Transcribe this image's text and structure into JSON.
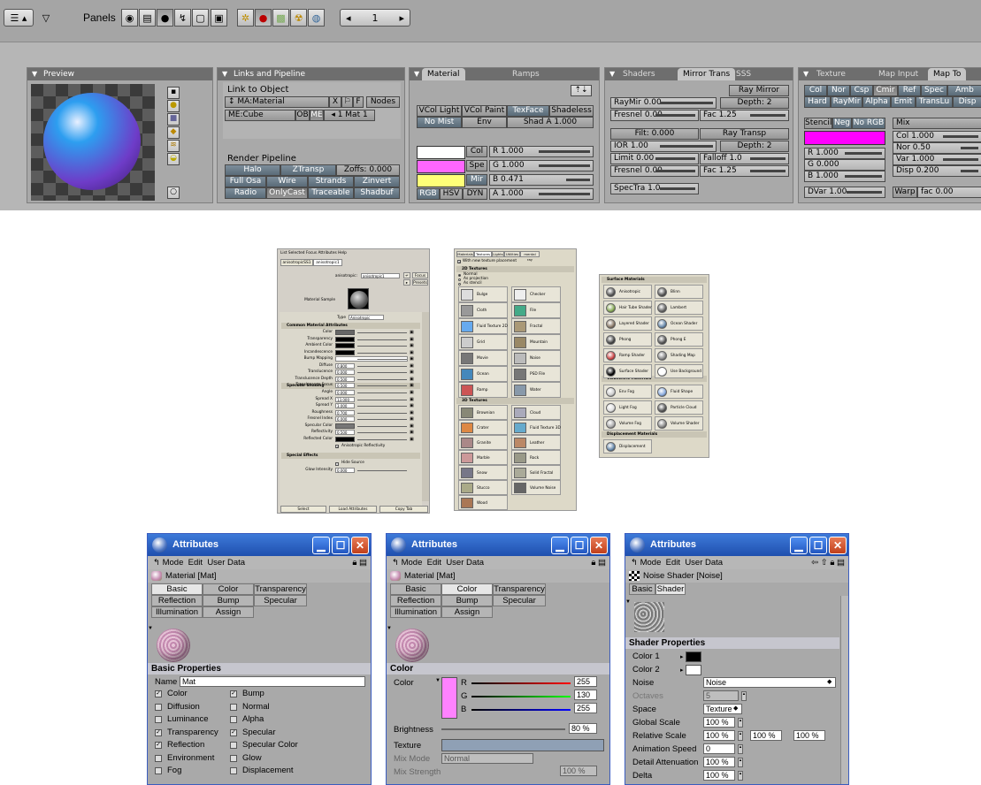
{
  "blender": {
    "header": {
      "panels_label": "Panels",
      "frame": "1"
    },
    "preview": {
      "title": "Preview"
    },
    "links": {
      "title": "Links and Pipeline",
      "link_to_object": "Link to Object",
      "ma_field": "MA:Material",
      "btn_x": "X",
      "btn_f": "F",
      "btn_nodes": "Nodes",
      "me_field": "ME:Cube",
      "ob": "OB",
      "me": "ME",
      "mat_index": "1 Mat 1",
      "render_pipeline": "Render Pipeline",
      "pipeline_rows": [
        [
          "Halo",
          "ZTransp",
          "Zoffs: 0.000"
        ],
        [
          "Full Osa",
          "Wire",
          "Strands",
          "Zinvert"
        ],
        [
          "Radio",
          "OnlyCast",
          "Traceable",
          "Shadbuf"
        ]
      ]
    },
    "material": {
      "title": "Material",
      "tab_ramps": "Ramps",
      "row1": [
        "VCol Light",
        "VCol Paint",
        "TexFace",
        "Shadeless"
      ],
      "row2": [
        "No Mist",
        "Env",
        "Shad A 1.000"
      ],
      "col": "Col",
      "spe": "Spe",
      "mir": "Mir",
      "r": "R 1.000",
      "g": "G 1.000",
      "b": "B 0.471",
      "rgb": "RGB",
      "hsv": "HSV",
      "dyn": "DYN",
      "a": "A 1.000",
      "colors": {
        "col": "#ffffff",
        "spe": "#ff66ff",
        "mir": "#ffff78"
      }
    },
    "shaders": {
      "title": "Shaders",
      "tab_mirror": "Mirror Trans",
      "tab_sss": "SSS",
      "ray_mirror": "Ray Mirror",
      "raymir": "RayMir 0.00",
      "depth1": "Depth: 2",
      "fresnel1": "Fresnel 0.00",
      "fac1": "Fac 1.25",
      "filt": "Filt: 0.000",
      "ray_transp": "Ray Transp",
      "ior": "IOR 1.00",
      "depth2": "Depth: 2",
      "limit": "Limit 0.00",
      "falloff": "Falloff 1.0",
      "fresnel2": "Fresnel 0.00",
      "fac2": "Fac 1.25",
      "spectra": "SpecTra 1.0"
    },
    "texture": {
      "title": "Texture",
      "tab_mapinput": "Map Input",
      "tab_mapto": "Map To",
      "row1": [
        "Col",
        "Nor",
        "Csp",
        "Cmir",
        "Ref",
        "Spec",
        "Amb"
      ],
      "row2": [
        "Hard",
        "RayMir",
        "Alpha",
        "Emit",
        "TransLu",
        "Disp"
      ],
      "stencil": "Stencil",
      "neg": "Neg",
      "norgb": "No RGB",
      "mix": "Mix",
      "col_val": "Col 1.000",
      "nor_val": "Nor 0.50",
      "var_val": "Var 1.000",
      "disp_val": "Disp 0.200",
      "r": "R 1.000",
      "g": "G 0.000",
      "b": "B 1.000",
      "dvar": "DVar 1.00",
      "warp": "Warp",
      "fac": "fac 0.00",
      "swatch": "#ff00ff"
    }
  },
  "maya1": {
    "menu": "List  Selected  Focus  Attributes  Help",
    "tabs": [
      "anisotropicSS1",
      "anisotropic1"
    ],
    "anisotropic_label": "anisotropic:",
    "anisotropic_value": "anisotropic1",
    "focus": "Focus",
    "presets": "Presets",
    "material_sample": "Material Sample",
    "type_label": "Type",
    "type_value": "Anisotropic",
    "common": "Common Material Attributes",
    "common_rows": [
      "Color",
      "Transparency",
      "Ambient Color",
      "Incandescence",
      "Bump Mapping",
      "Diffuse",
      "Translucence",
      "Translucence Depth",
      "Translucence Focus"
    ],
    "common_vals": [
      "",
      "",
      "",
      "",
      "",
      "0.800",
      "0.000",
      "0.500",
      "0.500"
    ],
    "specular": "Specular Shading",
    "spec_rows": [
      "Angle",
      "Spread X",
      "Spread Y",
      "Roughness",
      "Fresnel Index",
      "Specular Color",
      "Reflectivity",
      "Reflected Color"
    ],
    "spec_vals": [
      "0.000",
      "13.000",
      "3.000",
      "0.700",
      "6.000",
      "",
      "0.500",
      ""
    ],
    "aniso_reflectivity": "Anisotropic Reflectivity",
    "special": "Special Effects",
    "hide_source": "Hide Source",
    "glow_label": "Glow Intensity",
    "glow_value": "0.000",
    "bottom": [
      "Select",
      "Load Attributes",
      "Copy Tab"
    ]
  },
  "maya2": {
    "tabs": [
      "Materials",
      "Textures",
      "Lights",
      "Utilities",
      "mental ray"
    ],
    "with_new": "With new texture placement",
    "sec2d": "2D Textures",
    "radios": [
      "Normal",
      "As projection",
      "As stencil"
    ],
    "tex2d": [
      "Bulge",
      "Checker",
      "Cloth",
      "File",
      "Fluid Texture 2D",
      "Fractal",
      "Grid",
      "Mountain",
      "Movie",
      "Noise",
      "Ocean",
      "PSD File",
      "Ramp",
      "Water"
    ],
    "tooltip": "Mountain",
    "sec3d": "3D Textures",
    "tex3d": [
      "Brownian",
      "Cloud",
      "Crater",
      "Fluid Texture 3D",
      "Granite",
      "Leather",
      "Marble",
      "Rock",
      "Snow",
      "Solid Fractal",
      "Stucco",
      "Volume Noise",
      "Wood"
    ]
  },
  "maya3": {
    "surface": "Surface Materials",
    "surf_items": [
      "Anisotropic",
      "Blinn",
      "Hair Tube Shader",
      "Lambert",
      "Layered Shader",
      "Ocean Shader",
      "Phong",
      "Phong E",
      "Ramp Shader",
      "Shading Map",
      "Surface Shader",
      "Use Background"
    ],
    "volumetric": "Volumetric Materials",
    "vol_items": [
      "Env Fog",
      "Fluid Shape",
      "Light Fog",
      "Particle Cloud",
      "Volume Fog",
      "Volume Shader"
    ],
    "displacement": "Displacement Materials",
    "disp_items": [
      "Displacement"
    ]
  },
  "c4d1": {
    "title": "Attributes",
    "menu": [
      "Mode",
      "Edit",
      "User Data"
    ],
    "object": "Material [Mat]",
    "tabs": [
      "Basic",
      "Color",
      "Transparency",
      "Reflection",
      "Bump",
      "Specular",
      "Illumination",
      "Assign"
    ],
    "section": "Basic Properties",
    "name_label": "Name",
    "name_value": "Mat",
    "left": [
      [
        "Color",
        true
      ],
      [
        "Diffusion",
        false
      ],
      [
        "Luminance",
        false
      ],
      [
        "Transparency",
        true
      ],
      [
        "Reflection",
        true
      ],
      [
        "Environment",
        false
      ],
      [
        "Fog",
        false
      ]
    ],
    "right": [
      [
        "Bump",
        true
      ],
      [
        "Normal",
        false
      ],
      [
        "Alpha",
        false
      ],
      [
        "Specular",
        true
      ],
      [
        "Specular Color",
        false
      ],
      [
        "Glow",
        false
      ],
      [
        "Displacement",
        false
      ]
    ]
  },
  "c4d2": {
    "title": "Attributes",
    "menu": [
      "Mode",
      "Edit",
      "User Data"
    ],
    "object": "Material [Mat]",
    "tabs": [
      "Basic",
      "Color",
      "Transparency",
      "Reflection",
      "Bump",
      "Specular",
      "Illumination",
      "Assign"
    ],
    "section": "Color",
    "color_label": "Color",
    "r_label": "R",
    "g_label": "G",
    "b_label": "B",
    "r": "255",
    "g": "130",
    "b": "255",
    "brightness_label": "Brightness",
    "brightness": "80 %",
    "texture_label": "Texture",
    "mixmode_label": "Mix Mode",
    "mixmode": "Normal",
    "mixstrength_label": "Mix Strength",
    "mixstrength": "100 %",
    "swatch": "#ff82ff"
  },
  "c4d3": {
    "title": "Attributes",
    "menu": [
      "Mode",
      "Edit",
      "User Data"
    ],
    "object": "Noise Shader [Noise]",
    "tabs": [
      "Basic",
      "Shader"
    ],
    "section": "Shader Properties",
    "rows": [
      [
        "Color 1",
        ""
      ],
      [
        "Color 2",
        ""
      ],
      [
        "Noise",
        "Noise"
      ],
      [
        "Octaves",
        "5"
      ],
      [
        "Space",
        "Texture"
      ],
      [
        "Global Scale",
        "100 %"
      ],
      [
        "Relative Scale",
        "100 %"
      ],
      [
        "Animation Speed",
        "0"
      ],
      [
        "Detail Attenuation",
        "100 %"
      ],
      [
        "Delta",
        "100 %"
      ]
    ],
    "rel2": "100 %",
    "rel3": "100 %"
  }
}
